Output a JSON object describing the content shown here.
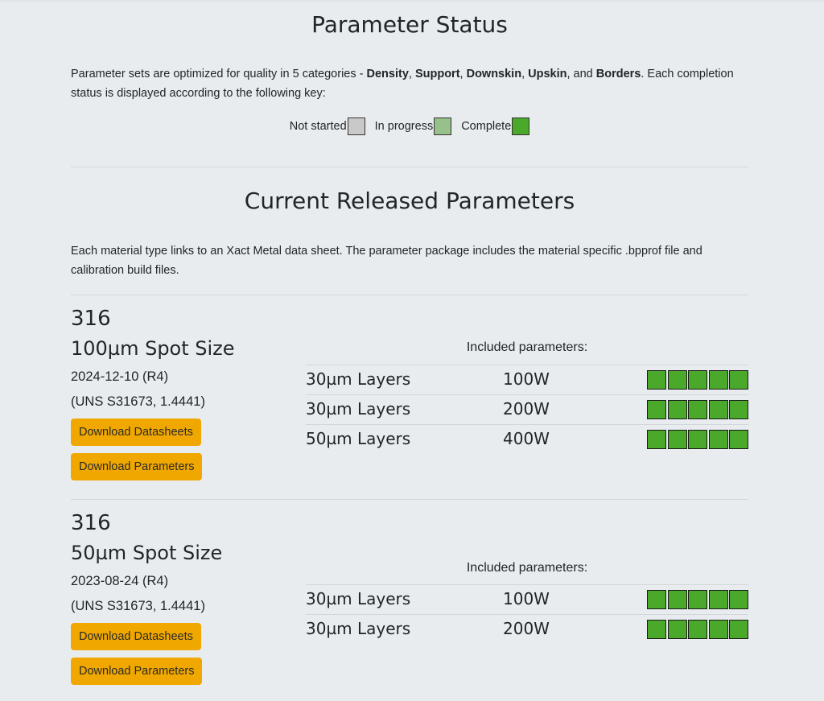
{
  "colors": {
    "not_started": "#c9c9c9",
    "in_progress": "#98c08a",
    "complete": "#4aa82a",
    "button": "#f0a800"
  },
  "status": {
    "title": "Parameter Status",
    "intro_lead": "Parameter sets are optimized for quality in 5 categories - ",
    "categories": [
      "Density",
      "Support",
      "Downskin",
      "Upskin",
      "Borders"
    ],
    "sep": ", ",
    "and": ", and ",
    "intro_tail": ". Each completion status is displayed according to the following key:",
    "legend": [
      {
        "label": "Not started",
        "state": "not_started"
      },
      {
        "label": "In progress",
        "state": "in_progress"
      },
      {
        "label": "Complete",
        "state": "complete"
      }
    ]
  },
  "released": {
    "title": "Current Released Parameters",
    "intro": "Each material type links to an Xact Metal data sheet. The parameter package includes the material specific .bpprof file and calibration build files."
  },
  "materials": [
    {
      "name": "316",
      "spot": "100µm Spot Size",
      "date": "2024-12-10 (R4)",
      "uns": "(UNS S31673, 1.4441)",
      "btn_datasheets": "Download Datasheets",
      "btn_parameters": "Download Parameters",
      "included_label": "Included parameters:",
      "params": [
        {
          "layer": "30µm Layers",
          "power": "100W",
          "status": [
            "complete",
            "complete",
            "complete",
            "complete",
            "complete"
          ]
        },
        {
          "layer": "30µm Layers",
          "power": "200W",
          "status": [
            "complete",
            "complete",
            "complete",
            "complete",
            "complete"
          ]
        },
        {
          "layer": "50µm Layers",
          "power": "400W",
          "status": [
            "complete",
            "complete",
            "complete",
            "complete",
            "complete"
          ]
        }
      ]
    },
    {
      "name": "316",
      "spot": "50µm Spot Size",
      "date": "2023-08-24 (R4)",
      "uns": "(UNS S31673, 1.4441)",
      "btn_datasheets": "Download Datasheets",
      "btn_parameters": "Download Parameters",
      "included_label": "Included parameters:",
      "params": [
        {
          "layer": "30µm Layers",
          "power": "100W",
          "status": [
            "complete",
            "complete",
            "complete",
            "complete",
            "complete"
          ]
        },
        {
          "layer": "30µm Layers",
          "power": "200W",
          "status": [
            "complete",
            "complete",
            "complete",
            "complete",
            "complete"
          ]
        }
      ]
    }
  ]
}
